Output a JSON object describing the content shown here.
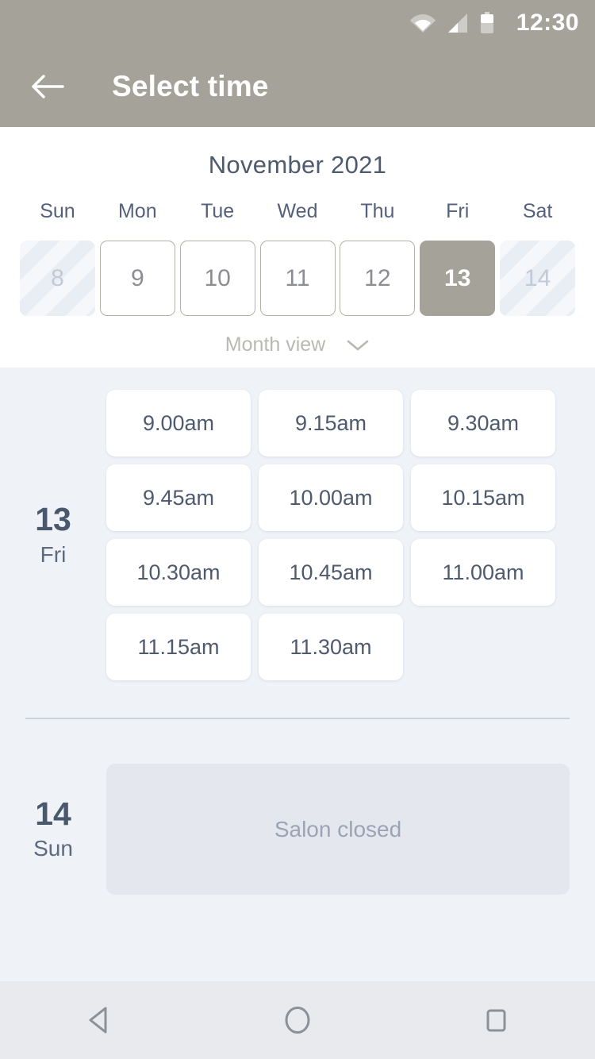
{
  "status_bar": {
    "time": "12:30",
    "icons": [
      "wifi-icon",
      "cellular-signal-icon",
      "battery-icon"
    ]
  },
  "app_bar": {
    "back_icon": "back-arrow-icon",
    "title": "Select time"
  },
  "calendar": {
    "month_title": "November 2021",
    "weekdays": [
      "Sun",
      "Mon",
      "Tue",
      "Wed",
      "Thu",
      "Fri",
      "Sat"
    ],
    "dates": [
      {
        "day": "8",
        "state": "disabled"
      },
      {
        "day": "9",
        "state": "available"
      },
      {
        "day": "10",
        "state": "available"
      },
      {
        "day": "11",
        "state": "available"
      },
      {
        "day": "12",
        "state": "available"
      },
      {
        "day": "13",
        "state": "selected"
      },
      {
        "day": "14",
        "state": "disabled"
      }
    ],
    "view_toggle": {
      "label": "Month view",
      "icon": "chevron-down-icon"
    }
  },
  "schedule": {
    "days": [
      {
        "day_number": "13",
        "weekday": "Fri",
        "slots": [
          "9.00am",
          "9.15am",
          "9.30am",
          "9.45am",
          "10.00am",
          "10.15am",
          "10.30am",
          "10.45am",
          "11.00am",
          "11.15am",
          "11.30am"
        ],
        "closed_message": null
      },
      {
        "day_number": "14",
        "weekday": "Sun",
        "slots": [],
        "closed_message": "Salon closed"
      }
    ]
  },
  "nav_bar": {
    "buttons": [
      {
        "name": "back-nav-button",
        "icon": "triangle-back-icon"
      },
      {
        "name": "home-nav-button",
        "icon": "circle-home-icon"
      },
      {
        "name": "recents-nav-button",
        "icon": "square-recents-icon"
      }
    ]
  },
  "colors": {
    "header_taupe": "#a5a399",
    "page_background": "#eff2f7",
    "slate_text": "#4e5a6e",
    "closed_panel": "#e4e8ee"
  }
}
